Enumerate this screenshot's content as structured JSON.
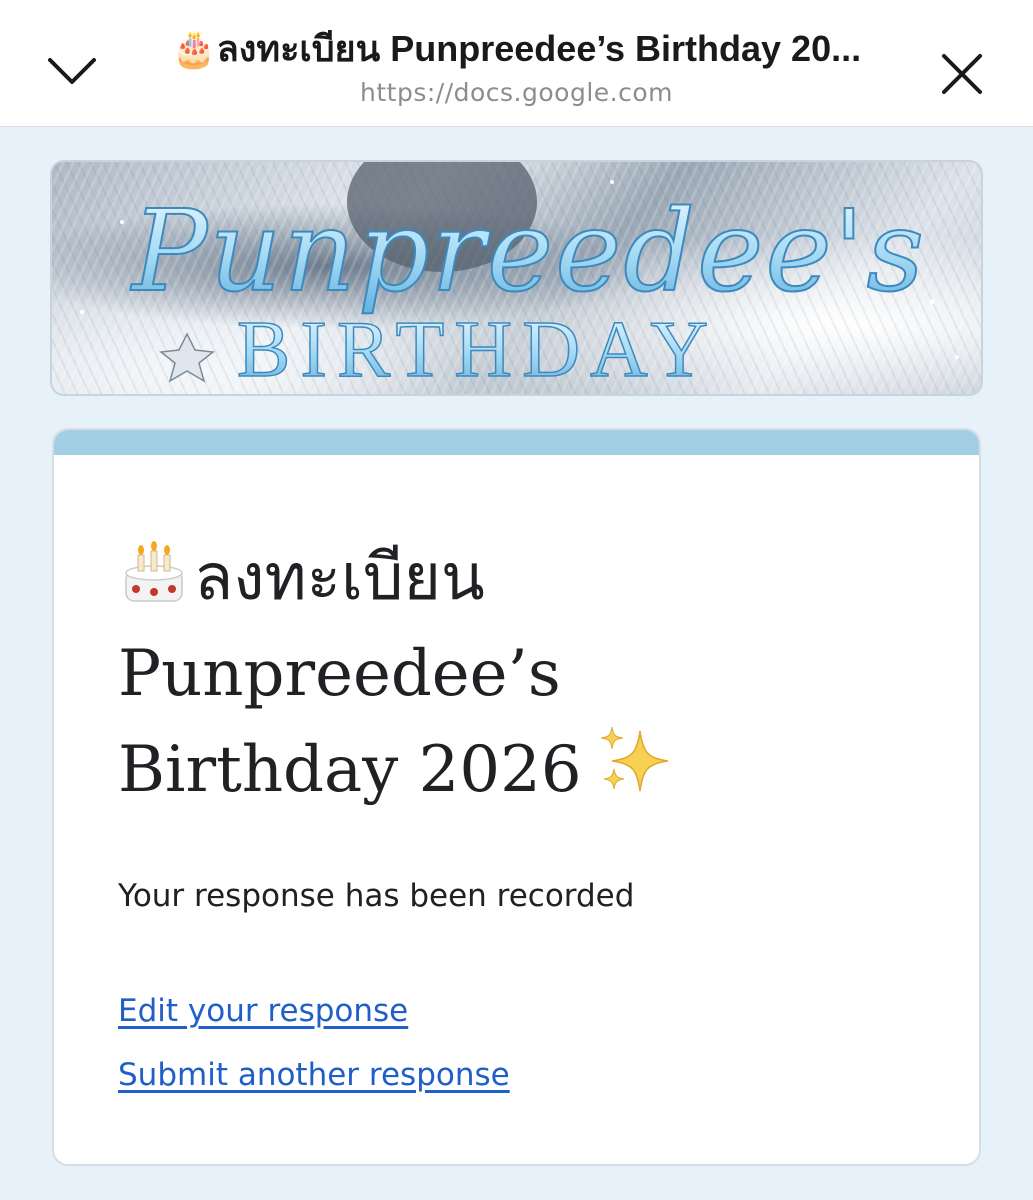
{
  "sheet": {
    "title": "🎂ลงทะเบียน Punpreedee’s Birthday 20...",
    "url": "https://docs.google.com"
  },
  "icons": {
    "collapse": "chevron-down-icon",
    "close": "close-icon",
    "title_emoji": "birthday-cake-icon",
    "sparkles": "sparkles-icon"
  },
  "banner": {
    "text_line1": "Punpreedee's",
    "text_line2": "BIRTHDAY"
  },
  "form": {
    "title_line1": "ลงทะเบียน",
    "title_line2": "Punpreedee’s",
    "title_line3": "Birthday 2026",
    "confirmation": "Your response has been recorded",
    "edit_link": "Edit your response",
    "submit_another_link": "Submit another response"
  },
  "colors": {
    "page_background": "#e7f1fa",
    "card_accent": "#a3cfe4",
    "link": "#1f5fc7",
    "text": "#202124"
  }
}
